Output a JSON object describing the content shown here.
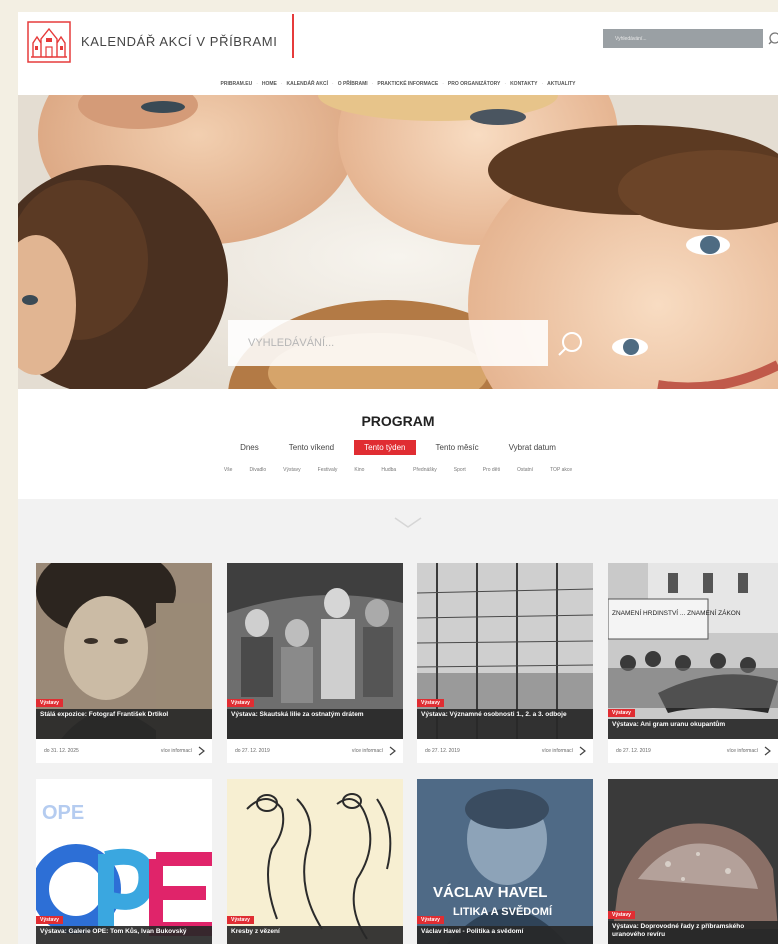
{
  "header": {
    "site_title": "KALENDÁŘ AKCÍ V PŘÍBRAMI",
    "search_placeholder": "Vyhledávání..."
  },
  "nav": {
    "items": [
      "PRIBRAM.EU",
      "HOME",
      "KALENDÁŘ AKCÍ",
      "O PŘÍBRAMI",
      "PRAKTICKÉ INFORMACE",
      "PRO ORGANIZÁTORY",
      "KONTAKTY",
      "AKTUALITY"
    ],
    "separator": "·"
  },
  "hero": {
    "search_placeholder": "VYHLEDÁVÁNÍ..."
  },
  "program": {
    "title": "PROGRAM",
    "periods": [
      "Dnes",
      "Tento víkend",
      "Tento týden",
      "Tento měsíc",
      "Vybrat datum"
    ],
    "active_period": "Tento týden",
    "categories": [
      "Vše",
      "Divadlo",
      "Výstavy",
      "Festivaly",
      "Kino",
      "Hudba",
      "Přednášky",
      "Sport",
      "Pro děti",
      "Ostatní",
      "TOP akce"
    ]
  },
  "cards": [
    {
      "tag": "Výstavy",
      "title": "Stálá expozice: Fotograf František Drtikol",
      "date": "do 31. 12. 2025",
      "more": "více informací"
    },
    {
      "tag": "Výstavy",
      "title": "Výstava: Skautská lilie za ostnatým drátem",
      "date": "do 27. 12. 2019",
      "more": "více informací"
    },
    {
      "tag": "Výstavy",
      "title": "Výstava: Významné osobnosti 1., 2. a 3. odboje",
      "date": "do 27. 12. 2019",
      "more": "více informací"
    },
    {
      "tag": "Výstavy",
      "title": "Výstava: Ani gram uranu okupantům",
      "date": "do 27. 12. 2019",
      "more": "více informací"
    },
    {
      "tag": "Výstavy",
      "title": "Výstava: Galerie OPE: Tom Kůs, Ivan Bukovský",
      "date": "",
      "more": ""
    },
    {
      "tag": "Výstavy",
      "title": "Kresby z vězení",
      "date": "",
      "more": ""
    },
    {
      "tag": "Výstavy",
      "title": "Václav Havel - Politika a svědomí",
      "date": "",
      "more": ""
    },
    {
      "tag": "Výstavy",
      "title": "Výstava: Doprovodné řady z příbramského uranového revíru",
      "date": "",
      "more": ""
    }
  ],
  "card_images": {
    "card8_overlay_line1": "VÁCLAV HAVEL",
    "card8_overlay_line2": "LITIKA A SVĚDOMÍ",
    "card5_letters": "OPE",
    "card4_banner": "ZNAMENÍ HRDINSTVÍ ... ZNAMENÍ ZÁKON"
  },
  "colors": {
    "accent": "#e02d32",
    "page_background": "#f3efe3",
    "cards_background": "#f2f2f2"
  },
  "icons": {
    "logo": "town-hall-logo-icon",
    "search": "search-icon",
    "chevron": "chevron-down-icon",
    "arrow": "chevron-right-icon"
  }
}
